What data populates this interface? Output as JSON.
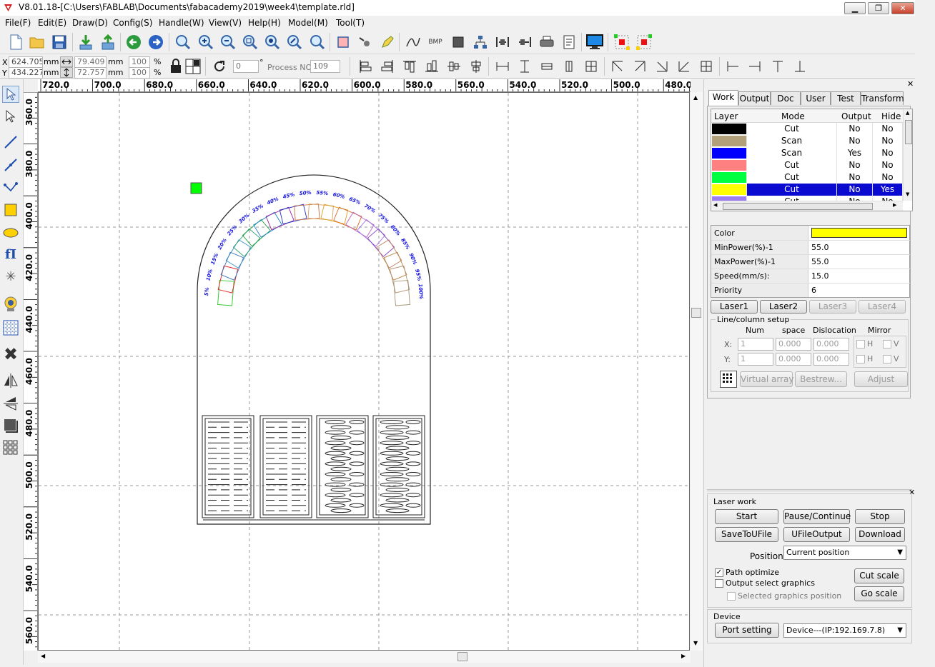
{
  "window": {
    "title": "V8.01.18-[C:\\Users\\FABLAB\\Documents\\fabacademy2019\\week4\\template.rld]",
    "minimize": "▁",
    "maximize": "❐",
    "close": "✕"
  },
  "menu": [
    "File(F)",
    "Edit(E)",
    "Draw(D)",
    "Config(S)",
    "Handle(W)",
    "View(V)",
    "Help(H)",
    "Model(M)",
    "Tool(T)"
  ],
  "toolbar": {
    "bmp_label": "BMP"
  },
  "coords": {
    "x_label": "X",
    "y_label": "Y",
    "x": "624.705",
    "y": "434.227",
    "unit": "mm",
    "width": "79.409",
    "height": "72.757",
    "scale_x": "100",
    "scale_y": "100",
    "percent": "%",
    "angle": "0",
    "degree": "°",
    "process_label": "Process NO:",
    "process_no": "109"
  },
  "ruler": {
    "h": [
      "720.0",
      "700.0",
      "680.0",
      "660.0",
      "640.0",
      "620.0",
      "600.0",
      "580.0",
      "560.0",
      "540.0",
      "520.0",
      "500.0",
      "480.0"
    ],
    "v": [
      "360.0",
      "380.0",
      "400.0",
      "420.0",
      "440.0",
      "460.0",
      "480.0",
      "500.0",
      "520.0",
      "540.0",
      "560.0"
    ]
  },
  "design": {
    "arch_labels": [
      "5%",
      "10%",
      "15%",
      "20%",
      "25%",
      "30%",
      "35%",
      "40%",
      "45%",
      "50%",
      "55%",
      "60%",
      "65%",
      "70%",
      "75%",
      "80%",
      "85%",
      "90%",
      "95%",
      "100%"
    ]
  },
  "panel": {
    "tabs": [
      "Work",
      "Output",
      "Doc",
      "User",
      "Test",
      "Transform"
    ],
    "layer_headers": [
      "Layer",
      "Mode",
      "Output",
      "Hide"
    ],
    "layers": [
      {
        "color": "#000000",
        "mode": "Cut",
        "output": "No",
        "hide": "No"
      },
      {
        "color": "#b2a07a",
        "mode": "Scan",
        "output": "No",
        "hide": "No"
      },
      {
        "color": "#0000ff",
        "mode": "Scan",
        "output": "Yes",
        "hide": "No"
      },
      {
        "color": "#ff8080",
        "mode": "Cut",
        "output": "No",
        "hide": "No"
      },
      {
        "color": "#00ff40",
        "mode": "Cut",
        "output": "No",
        "hide": "No"
      },
      {
        "color": "#ffff00",
        "mode": "Cut",
        "output": "No",
        "hide": "Yes"
      },
      {
        "color": "#9c7df0",
        "mode": "Cut",
        "output": "No",
        "hide": "No"
      }
    ],
    "selected_layer_index": 5,
    "props": [
      {
        "label": "Color",
        "value": ""
      },
      {
        "label": "MinPower(%)-1",
        "value": "55.0"
      },
      {
        "label": "MaxPower(%)-1",
        "value": "55.0"
      },
      {
        "label": "Speed(mm/s):",
        "value": "15.0"
      },
      {
        "label": "Priority",
        "value": "6"
      }
    ],
    "prop_color": "#ffff00",
    "lasers": [
      "Laser1",
      "Laser2",
      "Laser3",
      "Laser4"
    ],
    "array": {
      "title": "Line/column setup",
      "headers": [
        "Num",
        "space",
        "Dislocation",
        "Mirror"
      ],
      "x_label": "X:",
      "y_label": "Y:",
      "x": {
        "num": "1",
        "space": "0.000",
        "dislocation": "0.000"
      },
      "y": {
        "num": "1",
        "space": "0.000",
        "dislocation": "0.000"
      },
      "mirror_h": "H",
      "mirror_v": "V",
      "buttons": [
        "Virtual array",
        "Bestrew...",
        "Adjust"
      ]
    },
    "laserwork": {
      "title": "Laser work",
      "buttons": [
        "Start",
        "Pause/Continue",
        "Stop",
        "SaveToUFile",
        "UFileOutput",
        "Download"
      ],
      "position_label": "Position:",
      "position_value": "Current position",
      "path_optimize": "Path optimize",
      "output_select": "Output select graphics",
      "selected_position": "Selected graphics position",
      "cut_scale": "Cut scale",
      "go_scale": "Go scale"
    },
    "device": {
      "title": "Device",
      "port_setting": "Port setting",
      "value": "Device---(IP:192.169.7.8)"
    }
  }
}
